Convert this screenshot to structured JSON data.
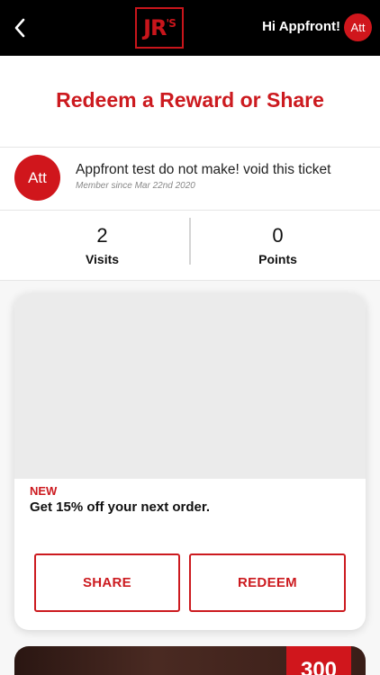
{
  "header": {
    "logo_text": "JR",
    "logo_suffix": "'S",
    "greeting": "Hi Appfront!",
    "avatar_initials": "Att"
  },
  "page": {
    "title": "Redeem a Reward or Share"
  },
  "profile": {
    "avatar_initials": "Att",
    "name": "Appfront test do not make! void this ticket",
    "member_since": "Member since Mar 22nd 2020"
  },
  "stats": {
    "visits_value": "2",
    "visits_label": "Visits",
    "points_value": "0",
    "points_label": "Points"
  },
  "rewards": [
    {
      "badge": "NEW",
      "description": "Get 15% off your next order.",
      "share_label": "SHARE",
      "redeem_label": "REDEEM"
    },
    {
      "points_cost": "300"
    }
  ],
  "colors": {
    "brand_red": "#cc1a1f",
    "header_bg": "#000000"
  }
}
